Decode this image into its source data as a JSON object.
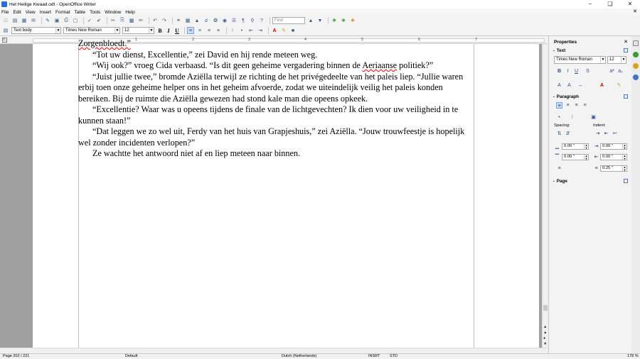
{
  "window": {
    "title": "Het Heilige Kwaad.odt - OpenOffice Writer",
    "minimize": "−",
    "maximize": "❏",
    "close": "✕"
  },
  "menu": [
    "File",
    "Edit",
    "View",
    "Insert",
    "Format",
    "Table",
    "Tools",
    "Window",
    "Help"
  ],
  "menu_close": "✕",
  "toolbar": {
    "find_placeholder": "Find"
  },
  "formatting": {
    "style": "Text body",
    "font": "Times New Roman",
    "size": "12",
    "bold": "B",
    "italic": "I",
    "underline": "U"
  },
  "ruler": {
    "marks": [
      "1",
      "2",
      "3",
      "4",
      "5",
      "6",
      "7"
    ],
    "tab_selector": "L"
  },
  "document": {
    "line0": "Zorgenbloedt.”",
    "p1": "“Tot uw dienst, Excellentie,” zei David en hij rende meteen weg.",
    "p2a": "“Wij ook?” vroeg Cida verbaasd. “Is dit geen geheime vergadering binnen de ",
    "p2b": "Aeriaanse",
    "p2c": " politiek?”",
    "p3": "“Juist jullie twee,” bromde Aziëlla terwijl ze richting de het privégedeelte van het paleis liep. “Jullie waren erbij toen onze geheime helper ons in het geheim afvoerde, zodat we uiteindelijk veilig het paleis konden bereiken. Bij de ruimte die Aziëlla gewezen had stond kale man die opeens opkeek.",
    "p4": "“Excellentie? Waar was u opeens tijdens de finale van de lichtgevechten? Ik dien voor uw veiligheid in te kunnen staan!”",
    "p5": "“Dat leggen we zo wel uit, Ferdy van het huis van Grapjeshuis,” zei Aziëlla. “Jouw trouwfeestje is hopelijk wel zonder incidenten verlopen?”",
    "p6": "Ze wachtte het antwoord niet af en liep meteen naar binnen."
  },
  "status": {
    "page": "Page 202 / 221",
    "style": "Default",
    "language": "Dutch (Netherlands)",
    "mode": "INSRT",
    "selection": "STD",
    "zoom": "178 %"
  },
  "sidebar": {
    "title": "Properties",
    "close": "✕",
    "text_section": "Text",
    "font": "Times New Roman",
    "size": "12",
    "paragraph_section": "Paragraph",
    "spacing_label": "Spacing:",
    "indent_label": "Indent:",
    "spacing_above": "0.00 \"",
    "spacing_below": "0.00 \"",
    "indent_before": "0.00 \"",
    "indent_after": "0.00 \"",
    "first_line": "0.25 \"",
    "page_section": "Page"
  },
  "colors": {
    "accent": "#2a6fd8",
    "spell_error": "#e00000",
    "workspace": "#a0a0a0"
  }
}
